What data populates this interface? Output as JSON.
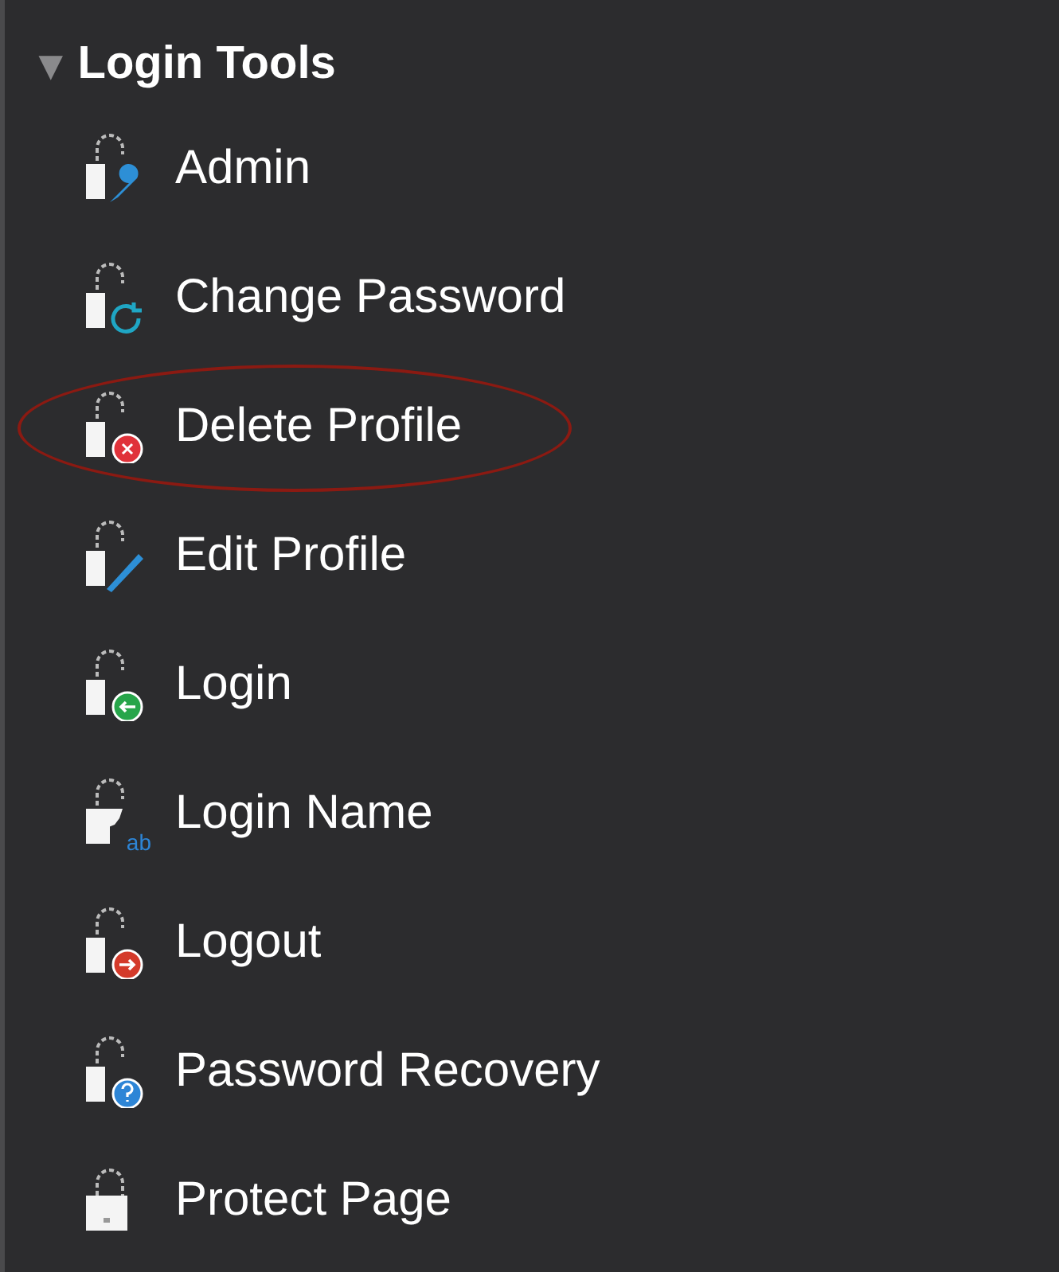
{
  "section": {
    "title": "Login Tools",
    "expanded": true,
    "toggle": "▼"
  },
  "items": [
    {
      "label": "Admin",
      "kind": "wrench",
      "highlighted": false
    },
    {
      "label": "Change Password",
      "kind": "refresh",
      "highlighted": false
    },
    {
      "label": "Delete Profile",
      "kind": "delete",
      "highlighted": true
    },
    {
      "label": "Edit Profile",
      "kind": "pencil",
      "highlighted": false
    },
    {
      "label": "Login",
      "kind": "login",
      "highlighted": false
    },
    {
      "label": "Login Name",
      "kind": "name",
      "badge_text": "ab",
      "highlighted": false
    },
    {
      "label": "Logout",
      "kind": "logout",
      "highlighted": false
    },
    {
      "label": "Password Recovery",
      "kind": "help",
      "highlighted": false
    },
    {
      "label": "Protect Page",
      "kind": "plain",
      "highlighted": false
    }
  ]
}
